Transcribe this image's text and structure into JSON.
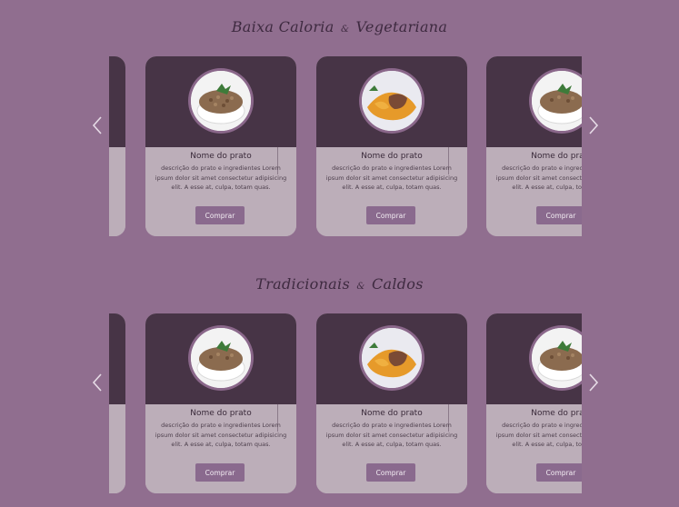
{
  "sections": [
    {
      "title_part1": "Baixa Caloria",
      "amp": "&",
      "title_part2": "Vegetariana",
      "cards": [
        {
          "name": "Nome do prato",
          "description": "descrição do prato e ingredientes Lorem ipsum dolor sit amet consectetur adipisicing elit. A esse at, culpa, totam quas.",
          "button": "Comprar",
          "image": "lentils-bowl"
        },
        {
          "name": "Nome do prato",
          "description": "descrição do prato e ingredientes Lorem ipsum dolor sit amet consectetur adipisicing elit. A esse at, culpa, totam quas.",
          "button": "Comprar",
          "image": "squash-meat-plate"
        },
        {
          "name": "Nome do prato",
          "description": "descrição do prato e ingredientes Lorem ipsum dolor sit amet consectetur adipisicing elit. A esse at, culpa, totam quas.",
          "button": "Comprar",
          "image": "lentils-bowl"
        }
      ]
    },
    {
      "title_part1": "Tradicionais",
      "amp": "&",
      "title_part2": "Caldos",
      "cards": [
        {
          "name": "Nome do prato",
          "description": "descrição do prato e ingredientes Lorem ipsum dolor sit amet consectetur adipisicing elit. A esse at, culpa, totam quas.",
          "button": "Comprar",
          "image": "lentils-bowl"
        },
        {
          "name": "Nome do prato",
          "description": "descrição do prato e ingredientes Lorem ipsum dolor sit amet consectetur adipisicing elit. A esse at, culpa, totam quas.",
          "button": "Comprar",
          "image": "squash-meat-plate"
        },
        {
          "name": "Nome do prato",
          "description": "descrição do prato e ingredientes Lorem ipsum dolor sit amet consectetur adipisicing elit. A esse at, culpa, totam quas.",
          "button": "Comprar",
          "image": "lentils-bowl"
        }
      ]
    }
  ],
  "icons": {
    "prev": "chevron-left-icon",
    "next": "chevron-right-icon"
  },
  "colors": {
    "background": "#906e8f",
    "card_top": "#473446",
    "card_bottom": "#bcaeb9",
    "button": "#8a6a8e"
  }
}
